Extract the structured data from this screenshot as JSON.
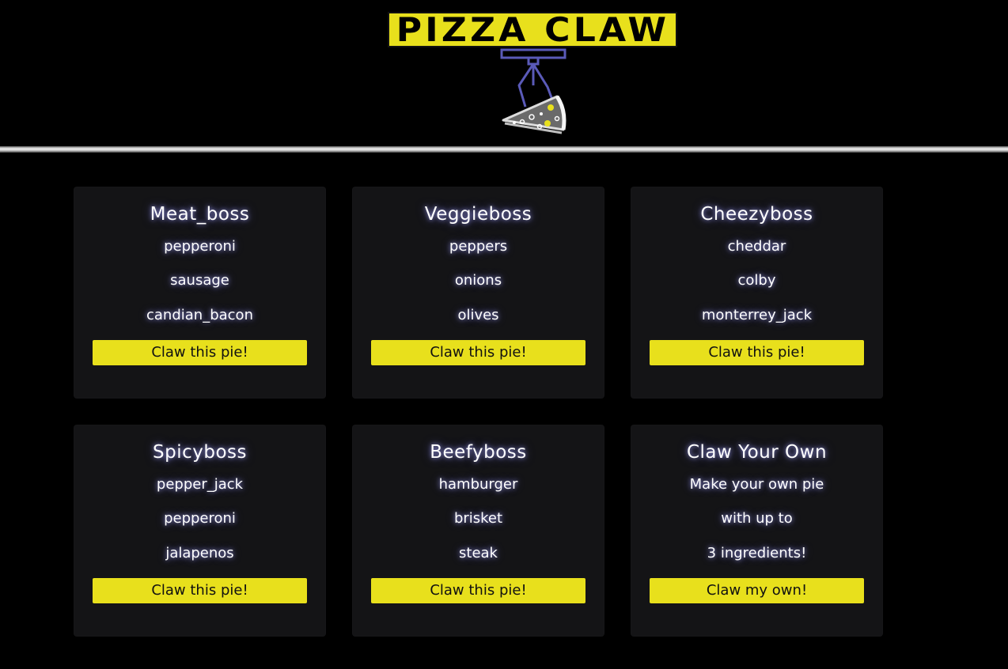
{
  "header": {
    "logo_text": "PIZZA CLAW",
    "brand_color": "#e8e01c",
    "claw_color": "#5a5ab8",
    "logo_icon": "claw-holding-pizza-icon"
  },
  "menu": {
    "cards": [
      {
        "title": "Meat_boss",
        "lines": [
          "pepperoni",
          "sausage",
          "candian_bacon"
        ],
        "button_label": "Claw this pie!"
      },
      {
        "title": "Veggieboss",
        "lines": [
          "peppers",
          "onions",
          "olives"
        ],
        "button_label": "Claw this pie!"
      },
      {
        "title": "Cheezyboss",
        "lines": [
          "cheddar",
          "colby",
          "monterrey_jack"
        ],
        "button_label": "Claw this pie!"
      },
      {
        "title": "Spicyboss",
        "lines": [
          "pepper_jack",
          "pepperoni",
          "jalapenos"
        ],
        "button_label": "Claw this pie!"
      },
      {
        "title": "Beefyboss",
        "lines": [
          "hamburger",
          "brisket",
          "steak"
        ],
        "button_label": "Claw this pie!"
      },
      {
        "title": "Claw Your Own",
        "lines": [
          "Make your own pie",
          "with up to",
          "3 ingredients!"
        ],
        "button_label": "Claw my own!"
      }
    ]
  }
}
